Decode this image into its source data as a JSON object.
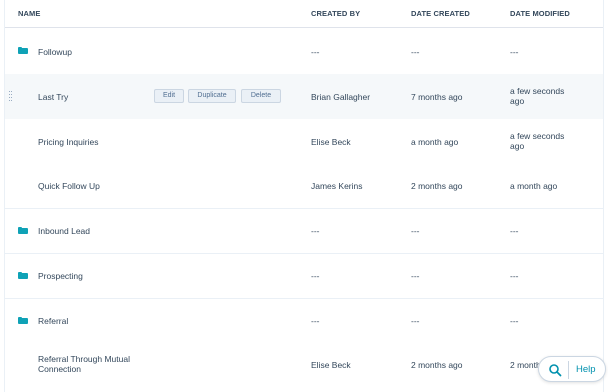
{
  "columns": {
    "name": "NAME",
    "created_by": "CREATED BY",
    "date_created": "DATE CREATED",
    "date_modified": "DATE MODIFIED"
  },
  "rows": [
    {
      "type": "folder",
      "name": "Followup",
      "created_by": "---",
      "date_created": "---",
      "date_modified": "---"
    },
    {
      "type": "template",
      "name": "Last Try",
      "created_by": "Brian Gallagher",
      "date_created": "7 months ago",
      "date_modified_line1": "a few seconds",
      "date_modified_line2": "ago"
    },
    {
      "type": "template",
      "name": "Pricing Inquiries",
      "created_by": "Elise Beck",
      "date_created": "a month ago",
      "date_modified_line1": "a few seconds",
      "date_modified_line2": "ago"
    },
    {
      "type": "template",
      "name": "Quick Follow Up",
      "created_by": "James Kerins",
      "date_created": "2 months ago",
      "date_modified": "a month ago"
    },
    {
      "type": "folder",
      "name": "Inbound Lead",
      "created_by": "---",
      "date_created": "---",
      "date_modified": "---"
    },
    {
      "type": "folder",
      "name": "Prospecting",
      "created_by": "---",
      "date_created": "---",
      "date_modified": "---"
    },
    {
      "type": "folder",
      "name": "Referral",
      "created_by": "---",
      "date_created": "---",
      "date_modified": "---"
    },
    {
      "type": "template",
      "name_line1": "Referral Through Mutual",
      "name_line2": "Connection",
      "created_by": "Elise Beck",
      "date_created": "2 months ago",
      "date_modified": "2 month"
    }
  ],
  "row_actions": {
    "edit": "Edit",
    "duplicate": "Duplicate",
    "delete": "Delete"
  },
  "help": {
    "icon": "search-icon",
    "label": "Help"
  },
  "colors": {
    "folder": "#0fa2b6",
    "text": "#33475b",
    "help_accent": "#0091ae"
  }
}
